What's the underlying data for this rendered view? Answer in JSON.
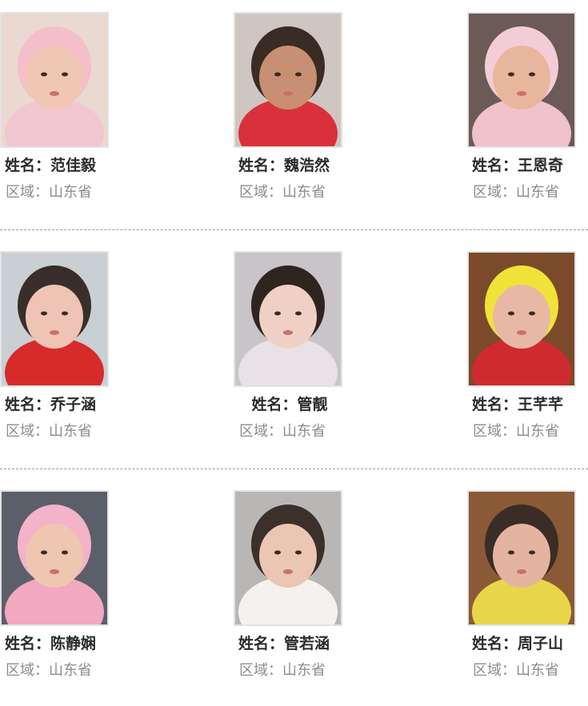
{
  "colors": {
    "name_text": "#2b2b2b",
    "region_text": "#8c8c8c",
    "divider": "#9a9a9a",
    "photo_border": "#e3e3e3"
  },
  "rows": [
    {
      "children": [
        {
          "name_label": "姓名：",
          "name": "范佳毅",
          "region_label": "区域：",
          "region": "山东省",
          "photo_bg": "#e9d9d0",
          "skin": "#f0c7b2",
          "wrap": "#f2c6d0",
          "hat": "#f4bfc8"
        },
        {
          "name_label": "姓名：",
          "name": "魏浩然",
          "region_label": "区域：",
          "region": "山东省",
          "photo_bg": "#cfc6c2",
          "skin": "#c98f72",
          "wrap": "#d9303c",
          "hat": "#3a2b25"
        },
        {
          "name_label": "姓名：",
          "name": "王恩奇",
          "region_label": "区域：",
          "region": "山东省",
          "photo_bg": "#6b5a55",
          "skin": "#e8b69c",
          "wrap": "#efc2cc",
          "hat": "#f2cdd6"
        }
      ]
    },
    {
      "children": [
        {
          "name_label": "姓名：",
          "name": "乔子涵",
          "region_label": "区域：",
          "region": "山东省",
          "photo_bg": "#c9cfd3",
          "skin": "#efc4b4",
          "wrap": "#d72b2b",
          "hat": "#3a2e2a"
        },
        {
          "name_label": "姓名：",
          "name": "管靓",
          "region_label": "区域：",
          "region": "山东省",
          "photo_bg": "#c8c4c7",
          "skin": "#f0d0c4",
          "wrap": "#e8e2e6",
          "hat": "#2e2420"
        },
        {
          "name_label": "姓名：",
          "name": "王芊芊",
          "region_label": "区域：",
          "region": "山东省",
          "photo_bg": "#7b4a2a",
          "skin": "#e7b9a4",
          "wrap": "#cf2b2f",
          "hat": "#f1e23a"
        }
      ]
    },
    {
      "children": [
        {
          "name_label": "姓名：",
          "name": "陈静娴",
          "region_label": "区域：",
          "region": "山东省",
          "photo_bg": "#5a5f6a",
          "skin": "#efc6b0",
          "wrap": "#f1a8c0",
          "hat": "#f3b3c9"
        },
        {
          "name_label": "姓名：",
          "name": "管若涵",
          "region_label": "区域：",
          "region": "山东省",
          "photo_bg": "#b9b7b6",
          "skin": "#ebc6b3",
          "wrap": "#f4f1ef",
          "hat": "#3c302b"
        },
        {
          "name_label": "姓名：",
          "name": "周子山",
          "region_label": "区域：",
          "region": "山东省",
          "photo_bg": "#8a5a36",
          "skin": "#e5b4a0",
          "wrap": "#e9d54a",
          "hat": "#3a2c26"
        }
      ]
    }
  ]
}
